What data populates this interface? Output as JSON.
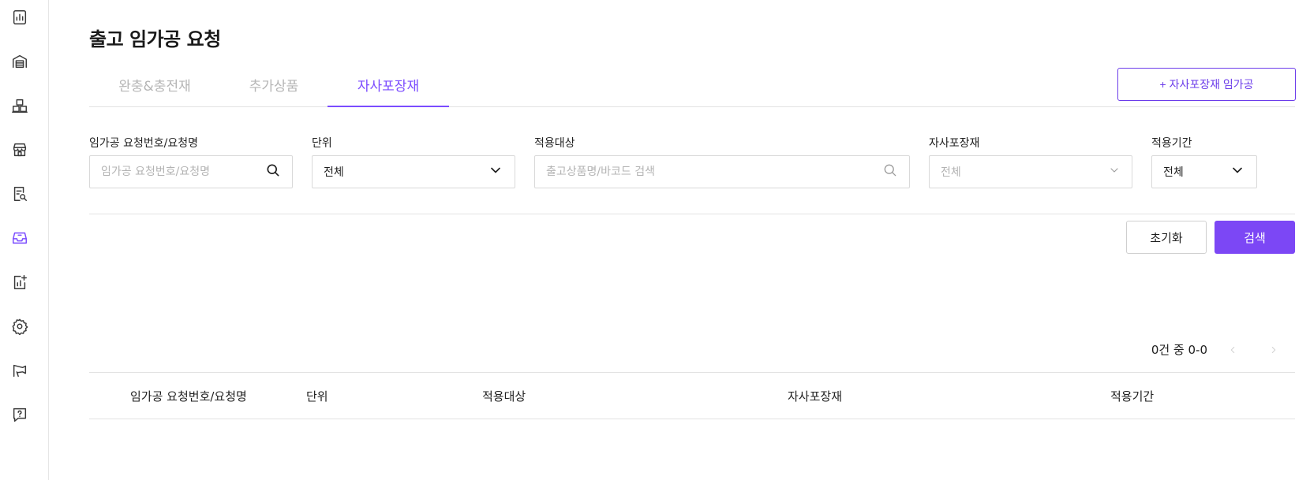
{
  "page": {
    "title": "출고 임가공 요청"
  },
  "sidebar": {
    "items": [
      {
        "icon": "chart-icon",
        "active": false
      },
      {
        "icon": "warehouse-icon",
        "active": false
      },
      {
        "icon": "boxes-icon",
        "active": false
      },
      {
        "icon": "store-icon",
        "active": false
      },
      {
        "icon": "document-search-icon",
        "active": false
      },
      {
        "icon": "inbox-icon",
        "active": true
      },
      {
        "icon": "report-add-icon",
        "active": false
      },
      {
        "icon": "gear-icon",
        "active": false
      },
      {
        "icon": "megaphone-icon",
        "active": false
      },
      {
        "icon": "help-chat-icon",
        "active": false
      }
    ]
  },
  "tabs": [
    {
      "label": "완충&충전재",
      "active": false
    },
    {
      "label": "추가상품",
      "active": false
    },
    {
      "label": "자사포장재",
      "active": true
    }
  ],
  "actions": {
    "add_label": "+ 자사포장재 임가공",
    "reset_label": "초기화",
    "search_label": "검색"
  },
  "filters": {
    "request": {
      "label": "임가공 요청번호/요청명",
      "placeholder": "임가공 요청번호/요청명",
      "value": ""
    },
    "unit": {
      "label": "단위",
      "value": "전체"
    },
    "target": {
      "label": "적용대상",
      "placeholder": "출고상품명/바코드 검색",
      "value": ""
    },
    "packaging": {
      "label": "자사포장재",
      "value": "전체"
    },
    "period": {
      "label": "적용기간",
      "value": "전체"
    }
  },
  "pagination": {
    "info": "0건 중 0-0"
  },
  "table": {
    "columns": [
      "임가공 요청번호/요청명",
      "단위",
      "적용대상",
      "자사포장재",
      "적용기간"
    ]
  },
  "colors": {
    "accent": "#7c47f5",
    "accent_border": "#6b3bea"
  }
}
